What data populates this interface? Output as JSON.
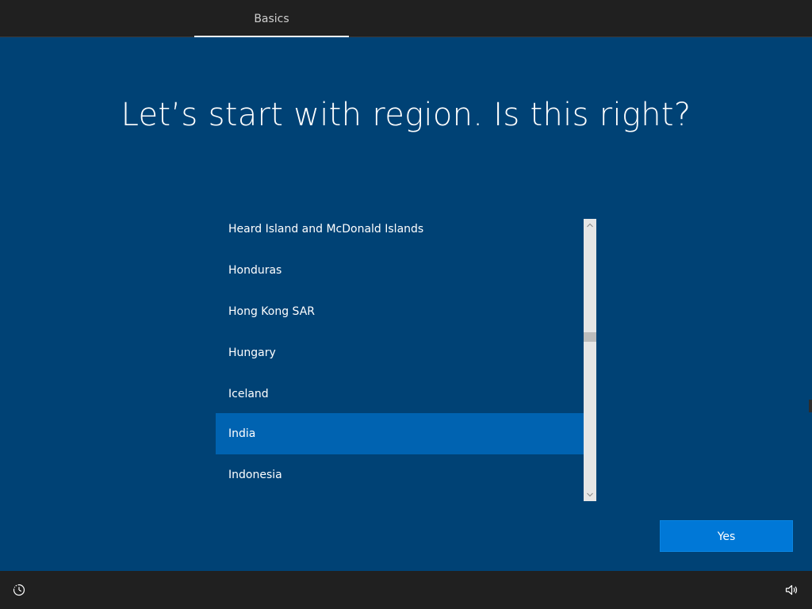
{
  "header": {
    "tabs": [
      {
        "label": "Basics",
        "active": true
      }
    ]
  },
  "main": {
    "title": "Let’s start with region. Is this right?",
    "regions": [
      "Heard Island and McDonald Islands",
      "Honduras",
      "Hong Kong SAR",
      "Hungary",
      "Iceland",
      "India",
      "Indonesia"
    ],
    "selected_region": "India",
    "yes_label": "Yes"
  },
  "footer": {
    "left_icon": "ease-of-access-icon",
    "right_icon": "volume-icon"
  },
  "colors": {
    "background": "#004275",
    "bars": "#202020",
    "selection": "#0063b1",
    "button": "#0078d7"
  }
}
